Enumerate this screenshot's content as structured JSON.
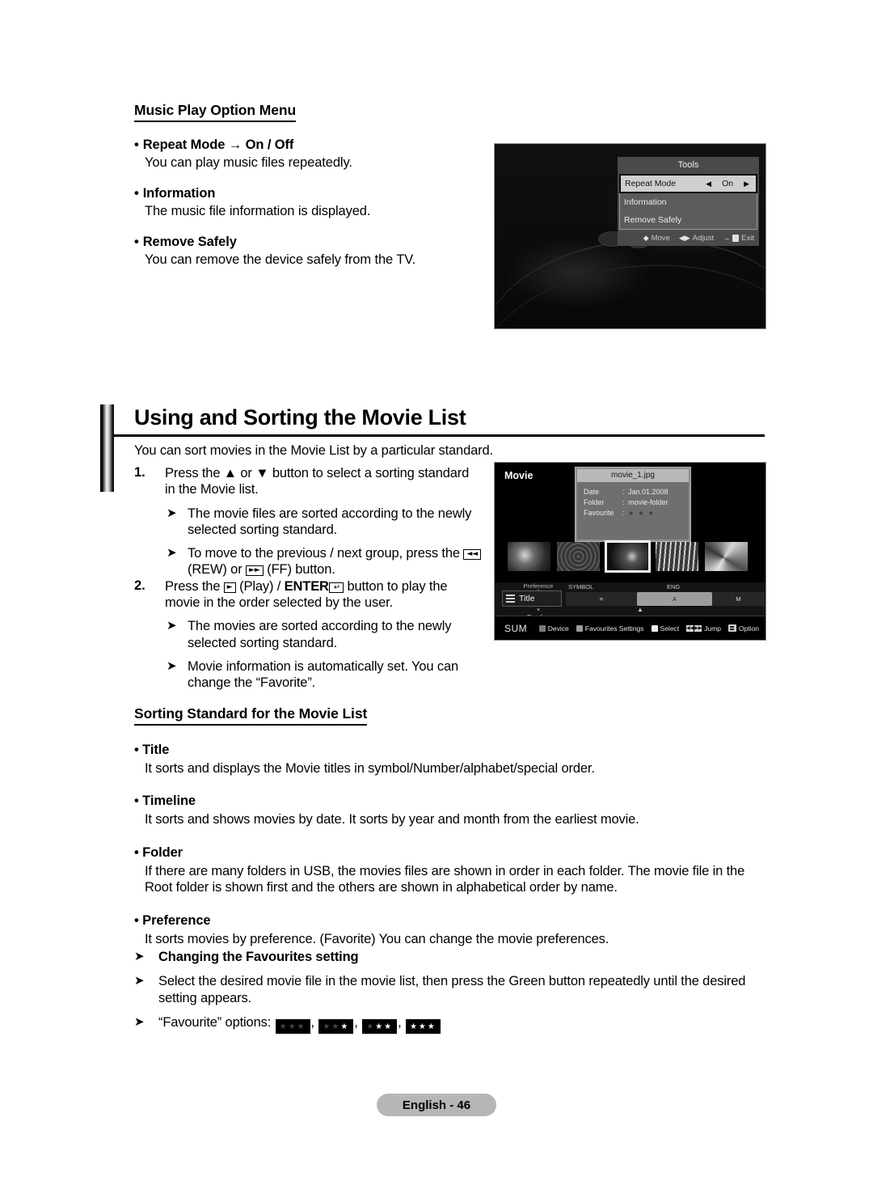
{
  "music_menu": {
    "heading": "Music Play Option Menu",
    "items": [
      {
        "title": "Repeat Mode → On / Off",
        "body": "You can play music files repeatedly."
      },
      {
        "title": "Information",
        "body": "The music file information is displayed."
      },
      {
        "title": "Remove Safely",
        "body": "You can remove the device safely from the TV."
      }
    ]
  },
  "tools_screen": {
    "title": "Tools",
    "rows": [
      {
        "label": "Repeat Mode",
        "value": "On",
        "left_arrow": "◀",
        "right_arrow": "▶",
        "selected": true
      },
      {
        "label": "Information",
        "value": "",
        "selected": false
      },
      {
        "label": "Remove Safely",
        "value": "",
        "selected": false
      }
    ],
    "footer": [
      {
        "icon": "up-down-arrow-icon",
        "glyph": "◆",
        "label": "Move"
      },
      {
        "icon": "left-right-arrow-icon",
        "glyph": "◀▶",
        "label": "Adjust"
      },
      {
        "icon": "exit-door-icon",
        "glyph": "→",
        "label": "Exit"
      }
    ]
  },
  "section": {
    "title": "Using and Sorting the Movie List",
    "intro": "You can sort movies in the Movie List by a particular standard.",
    "steps": [
      {
        "num": "1.",
        "text_before": "Press the ▲ or ▼ button to select a sorting standard in the Movie list.",
        "subs": [
          {
            "text": "The movie files are sorted according to the newly selected sorting standard."
          },
          {
            "pre": "To move to the previous / next group, press the ",
            "cap1": "◄◄",
            "mid": " (REW) or ",
            "cap2": "►►",
            "post": " (FF) button."
          }
        ]
      },
      {
        "num": "2.",
        "pre": "Press the ",
        "cap1": "►",
        "mid": " (Play) / ",
        "bold": "ENTER",
        "cap2": "↵",
        "post": " button to play the movie in the order selected by the user.",
        "subs": [
          {
            "text": "The movies are sorted according to the newly selected sorting standard."
          },
          {
            "text": "Movie information is automatically set. You can change the “Favorite”."
          }
        ]
      }
    ]
  },
  "movie_screen": {
    "label": "Movie",
    "file_name": "movie_1.jpg",
    "info": [
      {
        "key": "Date",
        "colon": ":",
        "value": "Jan.01.2008"
      },
      {
        "key": "Folder",
        "colon": ":",
        "value": "movie-folder"
      },
      {
        "key": "Favourite",
        "colon": ":",
        "value": "★ ★ ★"
      }
    ],
    "thumbnails": [
      {
        "name": "thumbnail-1",
        "selected": false
      },
      {
        "name": "thumbnail-2",
        "selected": false
      },
      {
        "name": "thumbnail-3",
        "selected": true
      },
      {
        "name": "thumbnail-4",
        "selected": false
      },
      {
        "name": "thumbnail-5",
        "selected": false
      }
    ],
    "sort_selector": {
      "above": "Preference",
      "current": "Title",
      "below": "Timeline"
    },
    "track": {
      "label_left": "SYMBOL",
      "label_right": "ENG",
      "segments": [
        "¤",
        "A",
        "M"
      ]
    },
    "footer": {
      "sum": "SUM",
      "items": [
        {
          "icon": "red-color-button-icon",
          "color": "#7a7a7a",
          "label": "Device"
        },
        {
          "icon": "green-color-button-icon",
          "color": "#9a9a9a",
          "label": "Favourites Settings"
        },
        {
          "icon": "yellow-color-button-icon",
          "color": "#f0f0f0",
          "label": "Select"
        },
        {
          "icon": "rew-ff-jump-icon",
          "label": "Jump"
        },
        {
          "icon": "tools-option-icon",
          "label": "Option"
        }
      ]
    }
  },
  "sorting_standard": {
    "heading": "Sorting Standard for the Movie List",
    "items": [
      {
        "title": "Title",
        "body": "It sorts and displays the Movie titles in symbol/Number/alphabet/special order."
      },
      {
        "title": "Timeline",
        "body": "It sorts and shows movies by date. It sorts by year and month from the earliest movie."
      },
      {
        "title": "Folder",
        "body": "If there are many folders in USB, the movies files are shown in order in each folder. The movie file in the Root folder is shown first and the others are shown in alphabetical order by name."
      },
      {
        "title": "Preference",
        "body": "It sorts movies by preference. (Favorite) You can change the movie preferences."
      }
    ]
  },
  "favourites": {
    "heading": "Changing the Favourites setting",
    "instruction": "Select the desired movie file in the movie list, then press the Green button repeatedly until the desired setting appears.",
    "options_label": "“Favourite” options:",
    "options": [
      {
        "on": 0,
        "off": 3
      },
      {
        "on": 1,
        "off": 2
      },
      {
        "on": 2,
        "off": 1
      },
      {
        "on": 3,
        "off": 0
      }
    ],
    "arrow": "➤"
  },
  "footer": {
    "page_label": "English - 46"
  }
}
